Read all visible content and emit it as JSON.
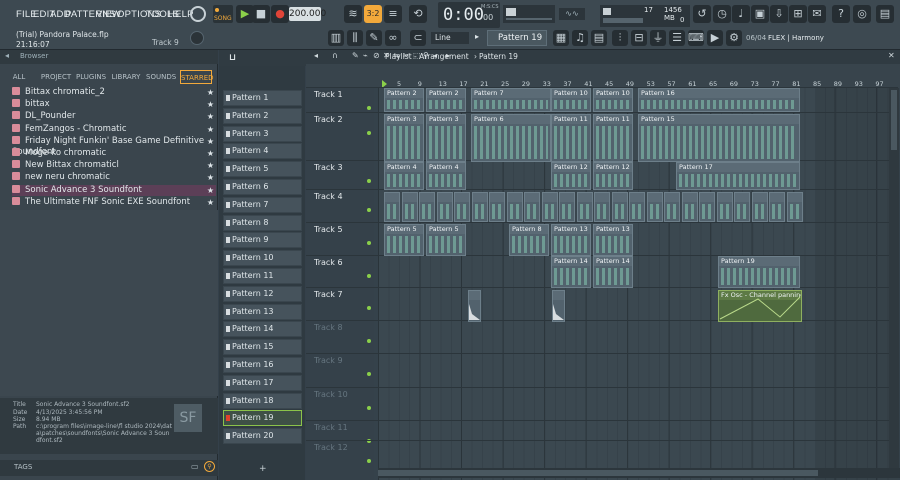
{
  "menu": [
    "FILE",
    "EDIT",
    "ADD",
    "PATTERNS",
    "VIEW",
    "OPTIONS",
    "TOOLS",
    "HELP"
  ],
  "transport": {
    "mode": "SONG",
    "tempo": "200.000",
    "time": "0:00",
    "time_suffix": "00",
    "time_label": "M:S:CS",
    "cpu": "17",
    "memory": "1456 MB",
    "voices": "0"
  },
  "project": {
    "title": "(Trial) Pandora Palace.flp",
    "time": "21:16:07",
    "track_hint": "Track 9"
  },
  "toolbar2": {
    "snap": "Line",
    "pattern": "Pattern 19",
    "news": "06/04",
    "news_text": "FLEX | Harmony"
  },
  "browser": {
    "title": "Browser",
    "tabs": [
      "ALL",
      "PROJECT",
      "PLUGINS",
      "LIBRARY",
      "SOUNDS",
      "STARRED"
    ],
    "items": [
      "Bittax chromatic_2",
      "bittax",
      "DL_Pounder",
      "FemZangos - Chromatic",
      "Friday Night Funkin' Base Game Definitive Soundfont",
      "Moge-ko chromatic",
      "New Bittax chromaticl",
      "new neru chromatic",
      "Sonic Advance 3 Soundfont",
      "The Ultimate FNF Sonic EXE Soundfont"
    ],
    "info": {
      "title_label": "Title",
      "title": "Sonic Advance 3 Soundfont.sf2",
      "date_label": "Date",
      "date": "4/13/2025 3:45:56 PM",
      "size_label": "Size",
      "size": "8.94 MB",
      "path_label": "Path",
      "path": "c:\\program files\\image-line\\fl studio 2024\\data\\patches\\soundfonts\\Sonic Advance 3 Soundfont.sf2"
    },
    "tags": "TAGS"
  },
  "patterns": [
    "Pattern 1",
    "Pattern 2",
    "Pattern 3",
    "Pattern 4",
    "Pattern 5",
    "Pattern 6",
    "Pattern 7",
    "Pattern 8",
    "Pattern 9",
    "Pattern 10",
    "Pattern 11",
    "Pattern 12",
    "Pattern 13",
    "Pattern 14",
    "Pattern 15",
    "Pattern 16",
    "Pattern 17",
    "Pattern 18",
    "Pattern 19",
    "Pattern 20"
  ],
  "playlist": {
    "title": "Playlist - Arrangement",
    "pattern": "Pattern 19",
    "ruler": [
      "5",
      "9",
      "13",
      "17",
      "21",
      "25",
      "29",
      "33",
      "37",
      "41",
      "45",
      "49",
      "53",
      "57",
      "61",
      "65",
      "69",
      "73",
      "77",
      "81",
      "85",
      "89",
      "93",
      "97"
    ],
    "tracks": [
      "Track 1",
      "Track 2",
      "Track 3",
      "Track 4",
      "Track 5",
      "Track 6",
      "Track 7",
      "Track 8",
      "Track 9",
      "Track 10",
      "Track 11",
      "Track 12"
    ],
    "clips": [
      {
        "t": "Pattern 2"
      },
      {
        "t": "Pattern 2"
      },
      {
        "t": "Pattern 7"
      },
      {
        "t": "Pattern 10"
      },
      {
        "t": "Pattern 10"
      },
      {
        "t": "Pattern 16"
      },
      {
        "t": "Pattern 3"
      },
      {
        "t": "Pattern 3"
      },
      {
        "t": "Pattern 6"
      },
      {
        "t": "Pattern 11"
      },
      {
        "t": "Pattern 11"
      },
      {
        "t": "Pattern 15"
      },
      {
        "t": "Pattern 4"
      },
      {
        "t": "Pattern 4"
      },
      {
        "t": "Pattern 12"
      },
      {
        "t": "Pattern 12"
      },
      {
        "t": "Pattern 17"
      },
      {
        "t": "Pattern 5"
      },
      {
        "t": "Pattern 5"
      },
      {
        "t": "Pattern 8"
      },
      {
        "t": "Pattern 13"
      },
      {
        "t": "Pattern 13"
      },
      {
        "t": "Pattern 14"
      },
      {
        "t": "Pattern 14"
      },
      {
        "t": "Pattern 19"
      },
      {
        "t": "Fx Osc - Channel panning"
      }
    ]
  }
}
